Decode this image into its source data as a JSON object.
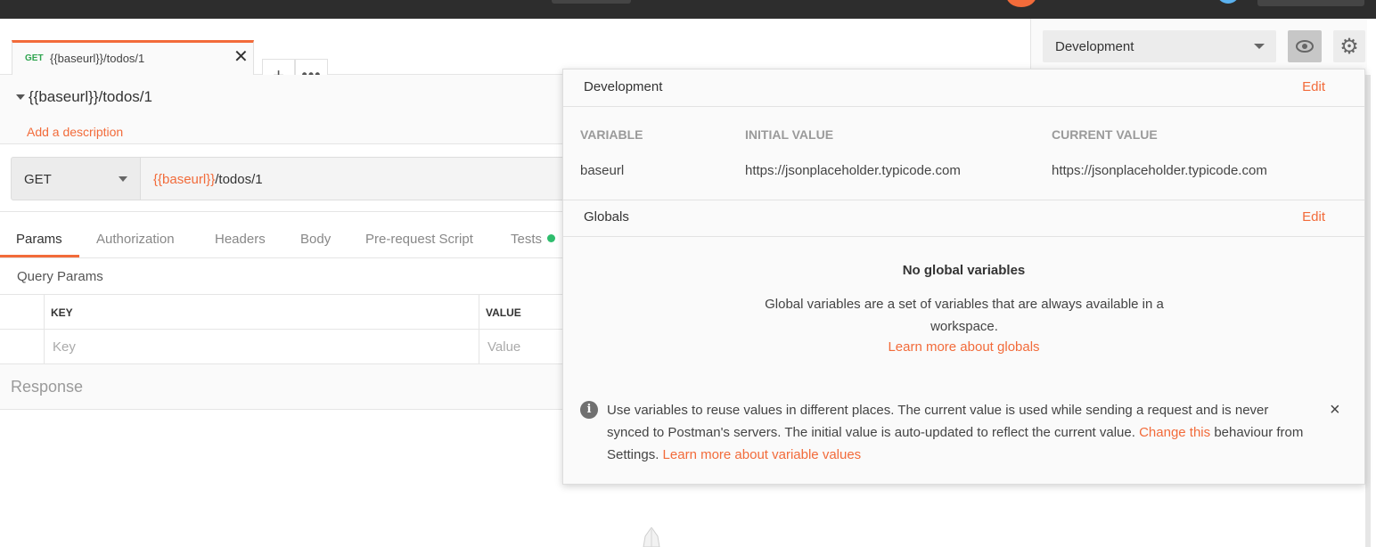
{
  "tab": {
    "method": "GET",
    "title": "{{baseurl}}/todos/1",
    "add_label": "+",
    "more_label": "•••"
  },
  "environment": {
    "selected": "Development"
  },
  "request": {
    "name": "{{baseurl}}/todos/1",
    "add_description": "Add a description",
    "method": "GET",
    "url_variable": "{{baseurl}}",
    "url_path": "/todos/1"
  },
  "request_tabs": [
    {
      "label": "Params"
    },
    {
      "label": "Authorization"
    },
    {
      "label": "Headers"
    },
    {
      "label": "Body"
    },
    {
      "label": "Pre-request Script"
    },
    {
      "label": "Tests"
    }
  ],
  "params": {
    "title": "Query Params",
    "key_header": "KEY",
    "value_header": "VALUE",
    "key_placeholder": "Key",
    "value_placeholder": "Value"
  },
  "response": {
    "label": "Response"
  },
  "popover": {
    "env_title": "Development",
    "edit_label": "Edit",
    "columns": [
      "VARIABLE",
      "INITIAL VALUE",
      "CURRENT VALUE"
    ],
    "variables": [
      {
        "name": "baseurl",
        "initial": "https://jsonplaceholder.typicode.com",
        "current": "https://jsonplaceholder.typicode.com"
      }
    ],
    "globals_title": "Globals",
    "globals_edit": "Edit",
    "no_globals_title": "No global variables",
    "no_globals_desc": "Global variables are a set of variables that are always available in a workspace.",
    "learn_globals": "Learn more about globals",
    "info_text_1": "Use variables to reuse values in different places. The current value is used while sending a request and is never synced to Postman's servers. The initial value is auto-updated to reflect the current value.",
    "info_link_1": "Change this",
    "info_text_2": "behaviour from Settings.",
    "info_link_2": "Learn more about variable values",
    "close_icon": "×"
  }
}
